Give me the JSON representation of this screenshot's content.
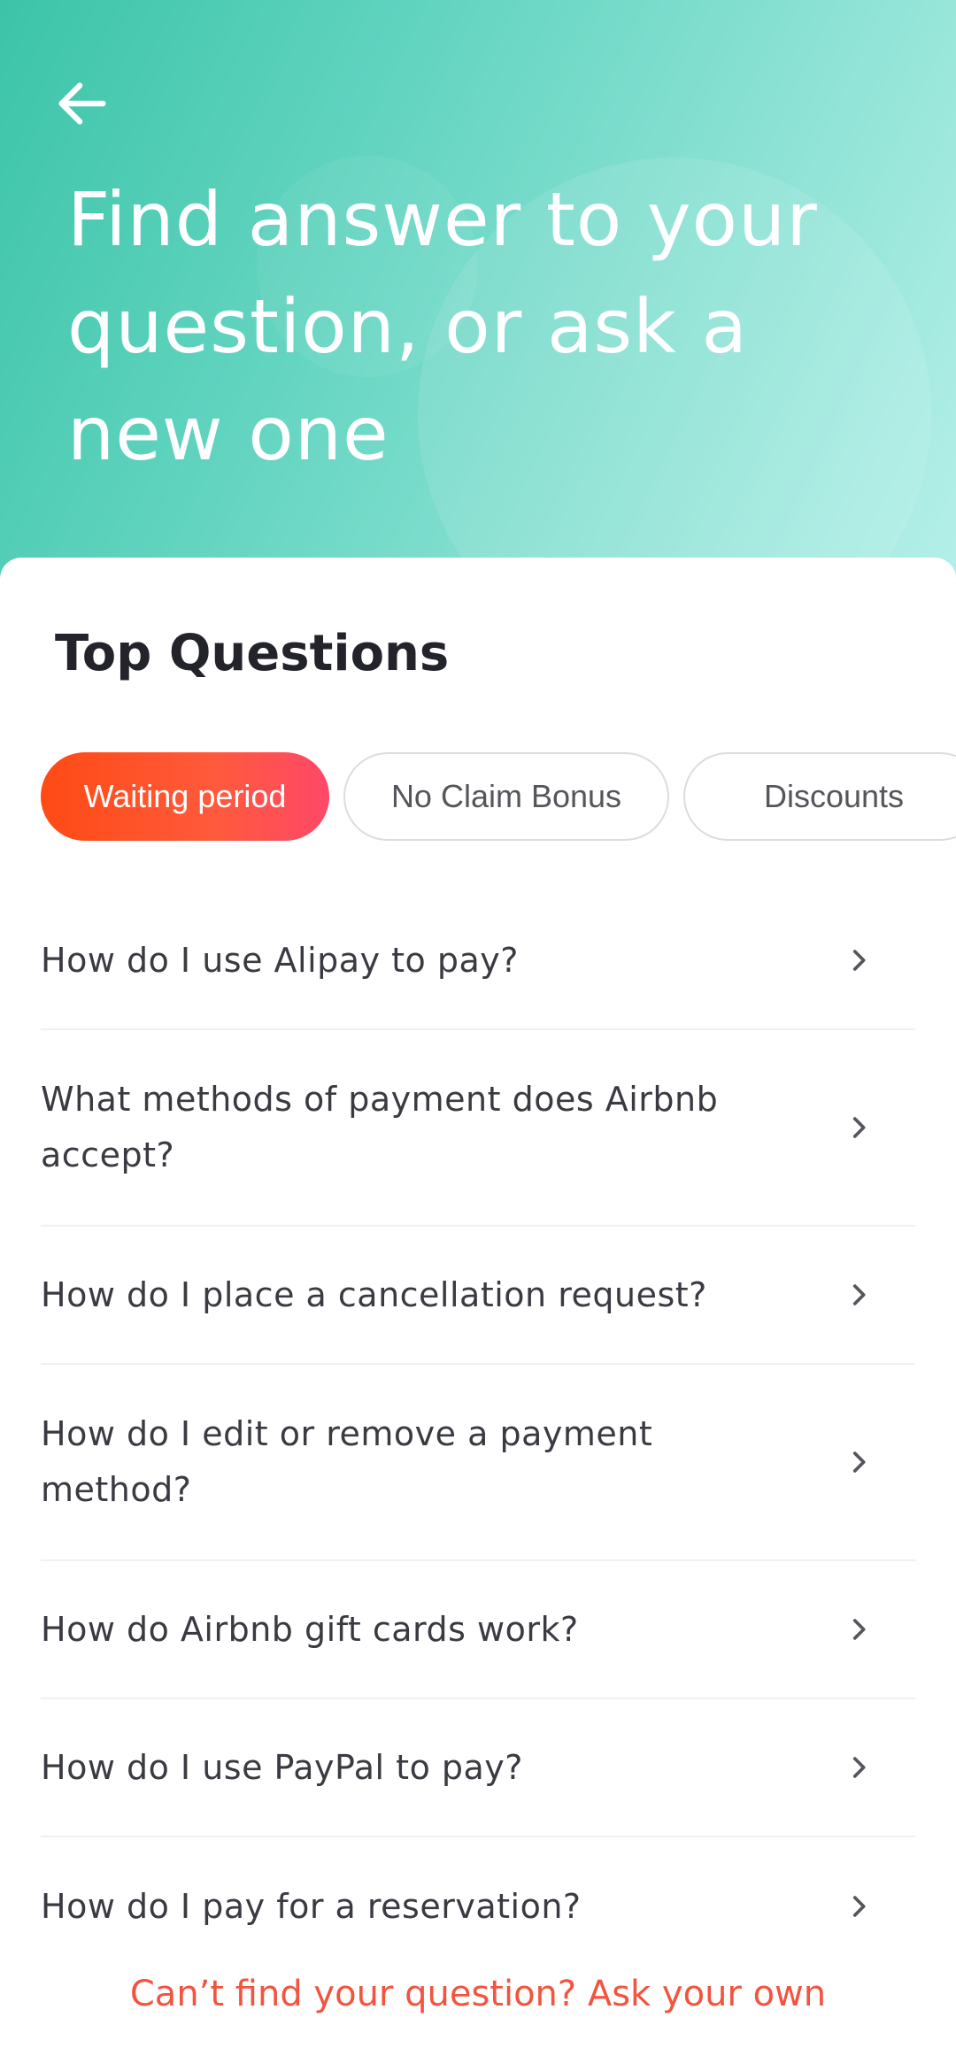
{
  "header": {
    "title": "Find answer to your question, or ask a new one",
    "back_icon": "arrow-left-icon"
  },
  "section": {
    "title": "Top Questions"
  },
  "chips": [
    {
      "label": "Waiting period",
      "active": true
    },
    {
      "label": "No Claim Bonus",
      "active": false
    },
    {
      "label": "Discounts",
      "active": false
    }
  ],
  "questions": [
    {
      "text": "How do I use Alipay to pay?"
    },
    {
      "text": "What methods of payment does Airbnb accept?"
    },
    {
      "text": "How do I place a cancellation request?"
    },
    {
      "text": "How do I edit or remove a payment method?"
    },
    {
      "text": "How do Airbnb gift cards work?"
    },
    {
      "text": "How do I use PayPal to pay?"
    },
    {
      "text": "How do I pay for a reservation?"
    }
  ],
  "footer": {
    "ask_link": "Can’t find your question? Ask your own"
  },
  "colors": {
    "hero_start": "#3cc4a8",
    "hero_end": "#b6f0ea",
    "accent": "#ff4a14",
    "link": "#f2543f"
  }
}
